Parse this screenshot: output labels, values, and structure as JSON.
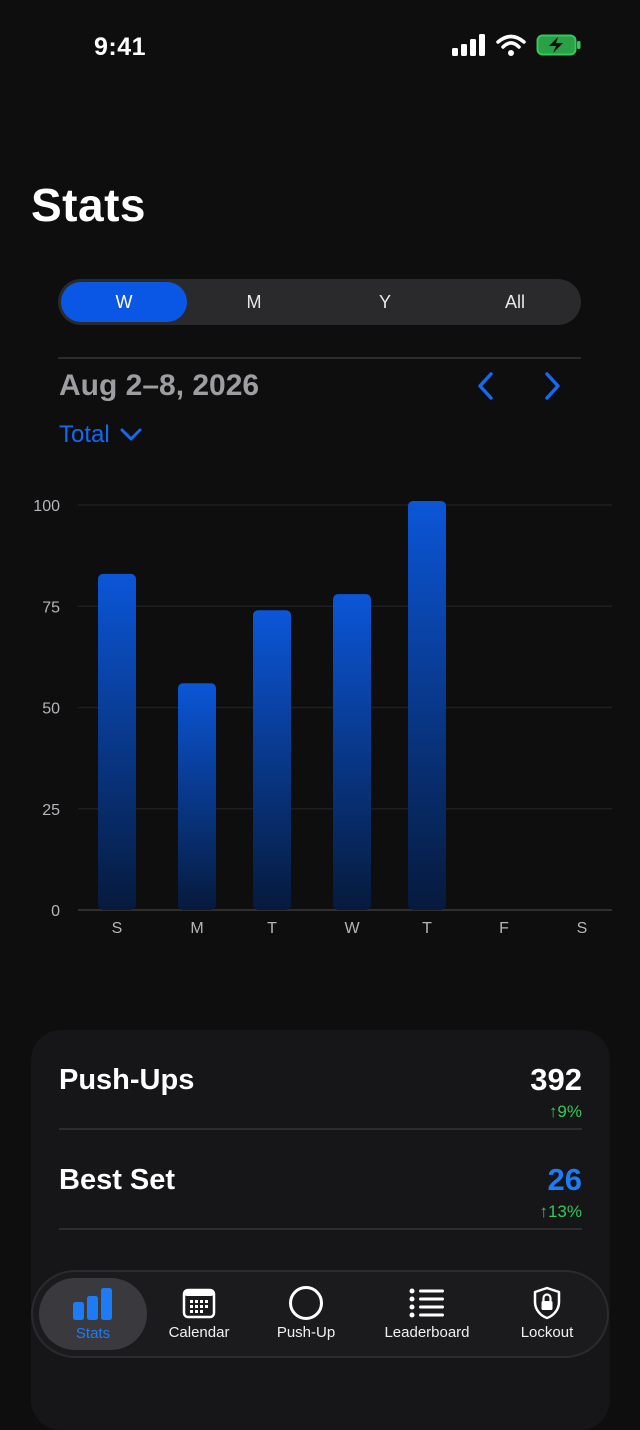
{
  "status_bar": {
    "time": "9:41"
  },
  "page": {
    "title": "Stats"
  },
  "period_tabs": [
    "W",
    "M",
    "Y",
    "All"
  ],
  "active_period": "W",
  "date_range": "Aug 2–8, 2026",
  "metric": "Total",
  "colors": {
    "accent": "#0a57e6",
    "positive": "#34c759",
    "bar_top": "#0b56d8",
    "bar_bottom": "#061a3c"
  },
  "chart_data": {
    "type": "bar",
    "categories": [
      "S",
      "M",
      "T",
      "W",
      "T",
      "F",
      "S"
    ],
    "values": [
      83,
      56,
      74,
      78,
      101,
      null,
      null
    ],
    "ylim": [
      0,
      100
    ],
    "yticks": [
      "0",
      "25",
      "50",
      "75",
      "100"
    ],
    "grid": true
  },
  "summary": {
    "pushups": {
      "label": "Push-Ups",
      "value": "392",
      "change": "↑9%"
    },
    "best_set": {
      "label": "Best Set",
      "value": "26",
      "change": "↑13%"
    }
  },
  "tabbar": {
    "items": [
      {
        "label": "Stats",
        "icon": "bar-chart-icon",
        "active": true
      },
      {
        "label": "Calendar",
        "icon": "calendar-icon"
      },
      {
        "label": "Push-Up",
        "icon": "circle-icon"
      },
      {
        "label": "Leaderboard",
        "icon": "list-icon"
      },
      {
        "label": "Lockout",
        "icon": "lock-shield-icon"
      }
    ]
  }
}
